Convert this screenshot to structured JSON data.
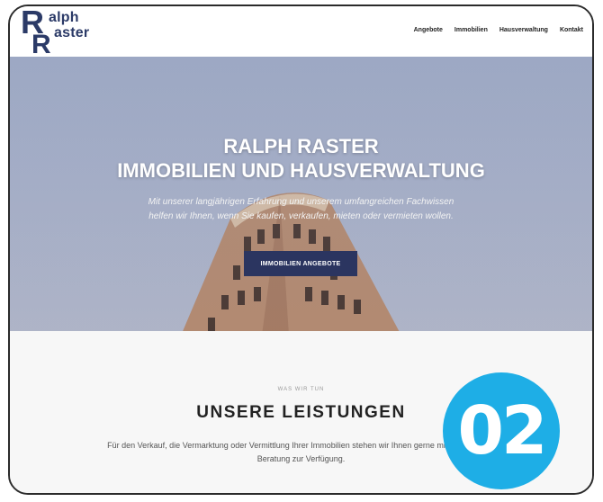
{
  "logo": {
    "line1": "alph",
    "line2": "aster",
    "mark": "RR-logo-mark"
  },
  "nav": {
    "items": [
      "Angebote",
      "Immobilien",
      "Hausverwaltung",
      "Kontakt"
    ]
  },
  "hero": {
    "title_line1": "RALPH RASTER",
    "title_line2": "IMMOBILIEN UND HAUSVERWALTUNG",
    "subtitle_line1": "Mit unserer langjährigen Erfahrung und unserem umfangreichen Fachwissen",
    "subtitle_line2": "helfen wir Ihnen, wenn Sie kaufen, verkaufen, mieten oder vermieten wollen.",
    "cta_label": "IMMOBILIEN ANGEBOTE"
  },
  "services": {
    "eyebrow": "WAS WIR TUN",
    "title": "UNSERE LEISTUNGEN",
    "text_line1": "Für den Verkauf, die Vermarktung oder Vermittlung Ihrer Immobilien stehen wir Ihnen gerne mit kompetenter",
    "text_line2": "Beratung zur Verfügung."
  },
  "badge": {
    "number": "02",
    "color": "#1eaee6"
  },
  "colors": {
    "brand": "#2b3a67",
    "cta": "#2b3560",
    "sky": "#a3aec8"
  }
}
